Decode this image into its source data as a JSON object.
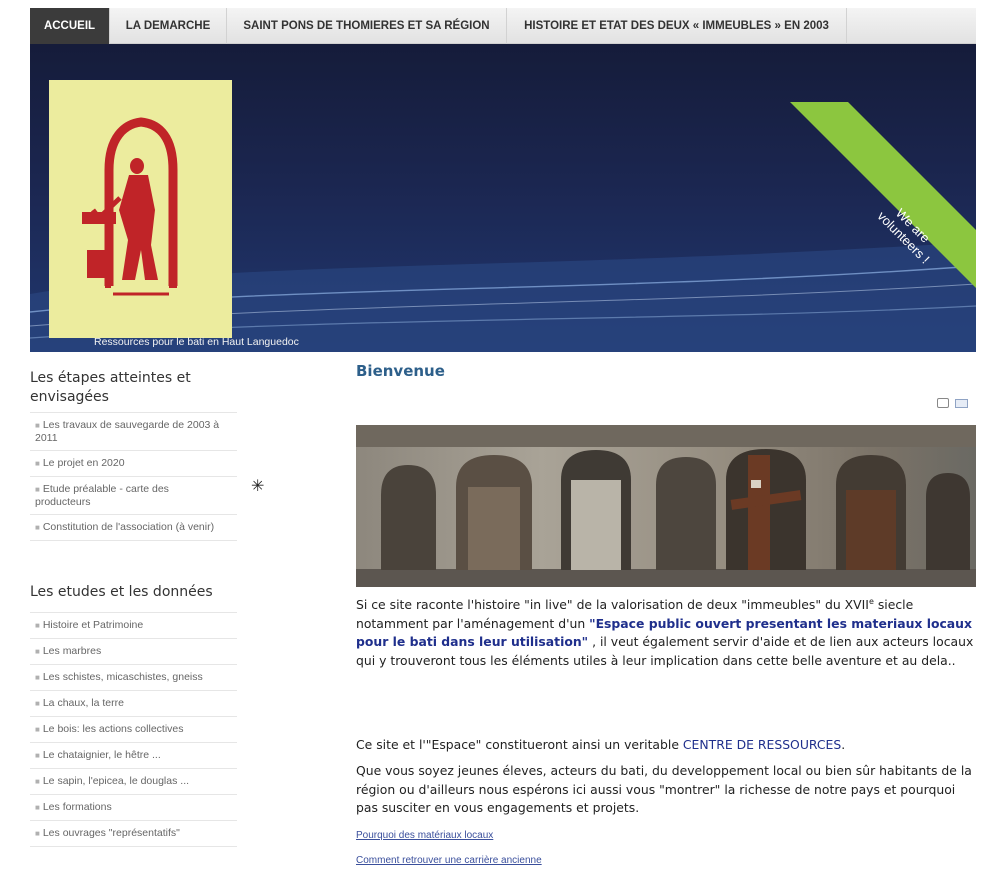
{
  "nav": {
    "tabs": [
      {
        "label": "ACCUEIL",
        "active": true
      },
      {
        "label": "LA DEMARCHE",
        "active": false
      },
      {
        "label": "SAINT PONS DE THOMIERES ET SA RÉGION",
        "active": false
      },
      {
        "label": "HISTOIRE ET ETAT DES DEUX « IMMEUBLES » EN 2003",
        "active": false
      }
    ]
  },
  "banner": {
    "tagline": "Ressources pour le bati en Haut Languedoc",
    "ribbon": "We are volunteers !",
    "colors": {
      "ribbon": "#8cc63f",
      "logo_bg": "#ecec9e",
      "logo_fig": "#c02428"
    }
  },
  "sidebar": {
    "section1": {
      "title": "Les étapes atteintes et envisagées",
      "items": [
        "Les travaux de sauvegarde de 2003 à 2011",
        "Le projet en 2020",
        "Etude préalable - carte des producteurs",
        "Constitution de l'association (à venir)"
      ]
    },
    "section2": {
      "title": "Les etudes et les données",
      "items": [
        "Histoire et Patrimoine",
        "Les marbres",
        "Les schistes, micaschistes, gneiss",
        "La chaux, la terre",
        "Le bois: les actions collectives",
        "Le chataignier, le hêtre ...",
        "Le sapin, l'epicea, le douglas ...",
        "Les formations",
        "Les ouvrages \"représentatifs\""
      ]
    }
  },
  "main": {
    "title": "Bienvenue",
    "tool_icons": [
      "print-icon",
      "email-icon"
    ],
    "p1": {
      "a": "Si ce site raconte l'histoire \"in live\" de la valorisation de deux \"immeubles\" du XVII",
      "sup": "e",
      "b": "siecle notamment par l'aménagement d'un ",
      "strong": "\"Espace public ouvert presentant les materiaux locaux pour le bati dans leur utilisation\"",
      "c": " , il veut également servir d'aide et de lien aux acteurs locaux qui y trouveront tous les éléments utiles à leur implication dans cette belle aventure et au dela.."
    },
    "p2": {
      "a": "Ce site et l'\"Espace\" constitueront ainsi  un veritable ",
      "hl": "CENTRE DE RESSOURCES",
      "b": "."
    },
    "p3": "Que vous soyez jeunes éleves, acteurs du bati, du developpement local ou bien sûr habitants de la région ou d'ailleurs nous espérons ici aussi vous \"montrer\" la richesse de notre pays et pourquoi pas susciter en vous engagements et projets.",
    "links": [
      "Pourquoi des matériaux locaux",
      "Comment retrouver une carrière ancienne"
    ]
  }
}
